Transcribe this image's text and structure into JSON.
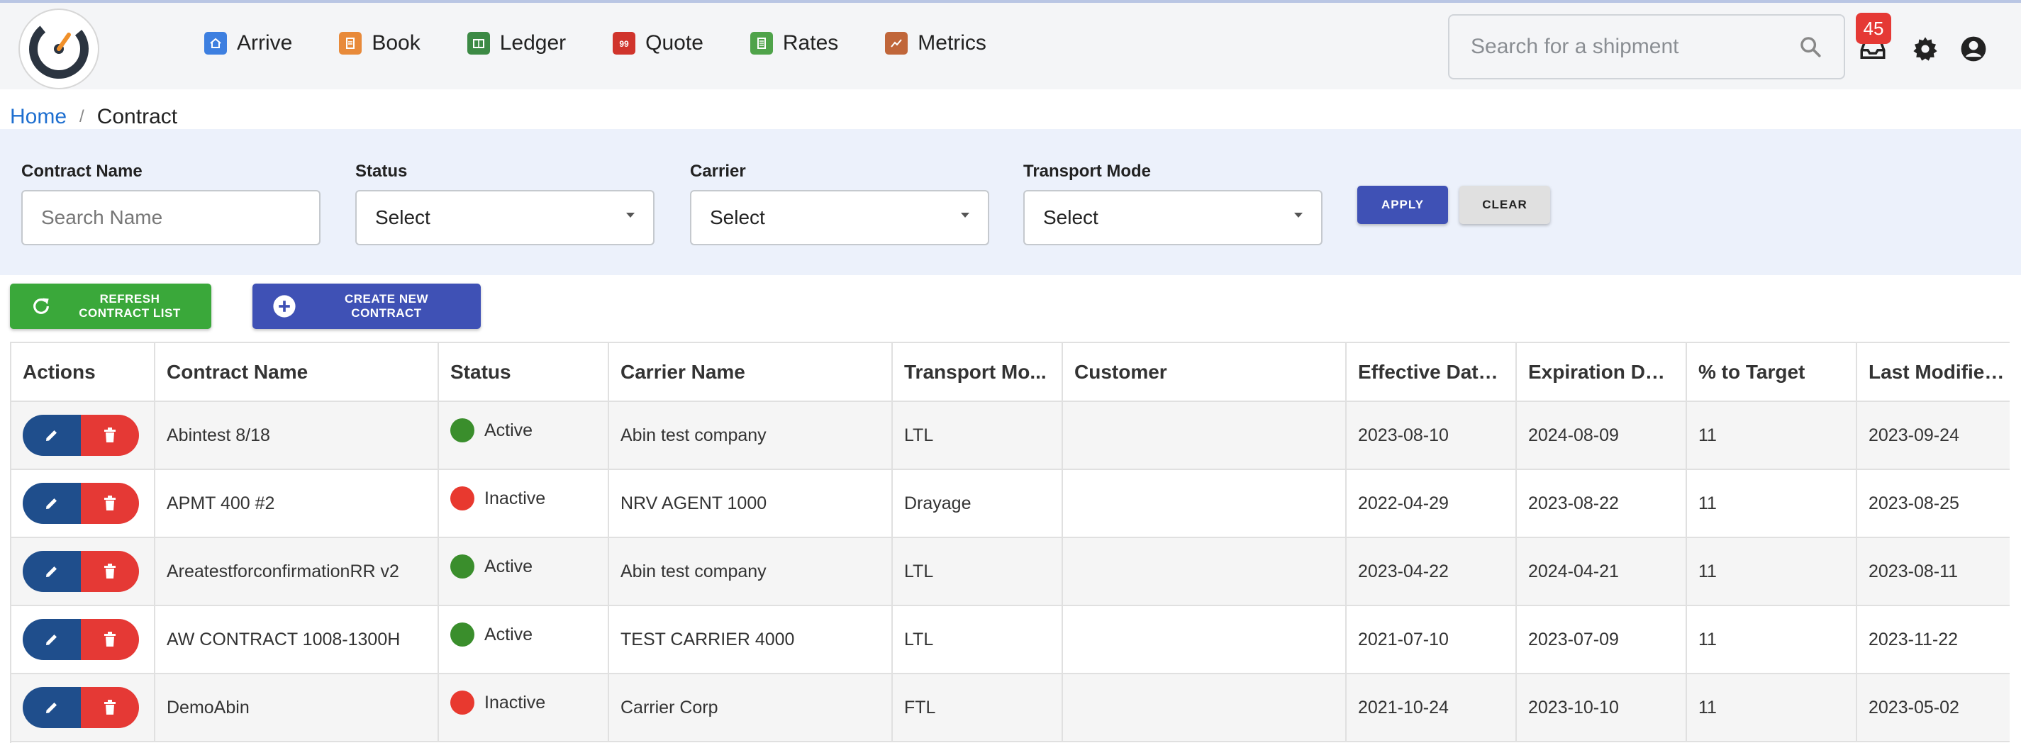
{
  "colors": {
    "active": "#3a8e2c",
    "inactive": "#e8392f",
    "primary": "#3f51b5",
    "refresh": "#3aa83a",
    "edit": "#1f4e8c",
    "delete": "#e53935",
    "link": "#1e6fd0"
  },
  "nav": {
    "items": [
      {
        "label": "Arrive",
        "icon": "home-icon",
        "color": "#3d7fe0"
      },
      {
        "label": "Book",
        "icon": "book-icon",
        "color": "#e88a3a"
      },
      {
        "label": "Ledger",
        "icon": "ledger-icon",
        "color": "#3c8a45"
      },
      {
        "label": "Quote",
        "icon": "quote-icon",
        "color": "#d0342c"
      },
      {
        "label": "Rates",
        "icon": "rates-icon",
        "color": "#4fa34a"
      },
      {
        "label": "Metrics",
        "icon": "metrics-icon",
        "color": "#c0663a"
      }
    ]
  },
  "header": {
    "search_placeholder": "Search for a shipment",
    "inbox_badge": "45"
  },
  "breadcrumb": {
    "home": "Home",
    "separator": "/",
    "current": "Contract"
  },
  "filters": {
    "contract_name_label": "Contract Name",
    "contract_name_placeholder": "Search Name",
    "status_label": "Status",
    "status_value": "Select",
    "carrier_label": "Carrier",
    "carrier_value": "Select",
    "mode_label": "Transport Mode",
    "mode_value": "Select",
    "apply": "APPLY",
    "clear": "CLEAR"
  },
  "actions": {
    "refresh": "REFRESH CONTRACT LIST",
    "create": "CREATE NEW CONTRACT"
  },
  "table": {
    "columns": [
      "Actions",
      "Contract Name",
      "Status",
      "Carrier Name",
      "Transport Mo...",
      "Customer",
      "Effective Date...",
      "Expiration Dat...",
      "% to Target",
      "Last Modified..."
    ],
    "rows": [
      {
        "name": "Abintest 8/18",
        "status": "Active",
        "status_color": "#3a8e2c",
        "carrier": "Abin test company",
        "mode": "LTL",
        "customer": "",
        "effective": "2023-08-10",
        "expiration": "2024-08-09",
        "target": "11",
        "modified": "2023-09-24"
      },
      {
        "name": "APMT 400 #2",
        "status": "Inactive",
        "status_color": "#e8392f",
        "carrier": "NRV AGENT 1000",
        "mode": "Drayage",
        "customer": "",
        "effective": "2022-04-29",
        "expiration": "2023-08-22",
        "target": "11",
        "modified": "2023-08-25"
      },
      {
        "name": "AreatestforconfirmationRR v2",
        "status": "Active",
        "status_color": "#3a8e2c",
        "carrier": "Abin test company",
        "mode": "LTL",
        "customer": "",
        "effective": "2023-04-22",
        "expiration": "2024-04-21",
        "target": "11",
        "modified": "2023-08-11"
      },
      {
        "name": "AW CONTRACT 1008-1300H",
        "status": "Active",
        "status_color": "#3a8e2c",
        "carrier": "TEST CARRIER 4000",
        "mode": "LTL",
        "customer": "",
        "effective": "2021-07-10",
        "expiration": "2023-07-09",
        "target": "11",
        "modified": "2023-11-22"
      },
      {
        "name": "DemoAbin",
        "status": "Inactive",
        "status_color": "#e8392f",
        "carrier": "Carrier Corp",
        "mode": "FTL",
        "customer": "",
        "effective": "2021-10-24",
        "expiration": "2023-10-10",
        "target": "11",
        "modified": "2023-05-02"
      }
    ]
  }
}
